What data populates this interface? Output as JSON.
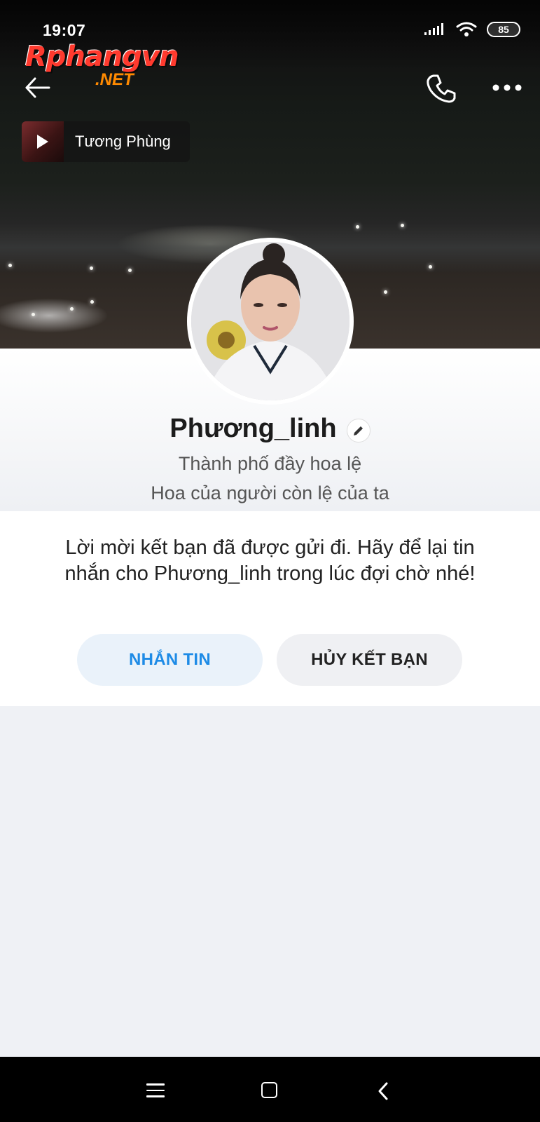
{
  "status_bar": {
    "time": "19:07",
    "battery": "85",
    "icons": [
      "signal-icon",
      "wifi-icon",
      "battery-icon"
    ]
  },
  "watermark": {
    "main": "Rphangvn",
    "sub": ".NET"
  },
  "header": {
    "back_icon": "arrow-left-icon",
    "call_icon": "phone-icon",
    "more_icon": "more-dots-icon"
  },
  "music": {
    "title": "Tương Phùng",
    "icon": "play-icon"
  },
  "profile": {
    "name": "Phương_linh",
    "edit_icon": "pencil-icon",
    "bio_line1": "Thành phố đầy hoa lệ",
    "bio_line2": "Hoa của người còn lệ của ta"
  },
  "friend_request": {
    "message": "Lời mời kết bạn đã được gửi đi. Hãy để lại tin nhắn cho Phương_linh trong lúc đợi chờ nhé!",
    "message_button": "NHẮN TIN",
    "cancel_button": "HỦY KẾT BẠN"
  },
  "colors": {
    "accent": "#1e8be6",
    "message_button_bg": "#eaf2fa",
    "cancel_button_bg": "#eff0f3",
    "page_bg": "#eff1f5"
  },
  "navbar": {
    "icons": [
      "menu-icon",
      "home-square-icon",
      "back-chevron-icon"
    ]
  }
}
